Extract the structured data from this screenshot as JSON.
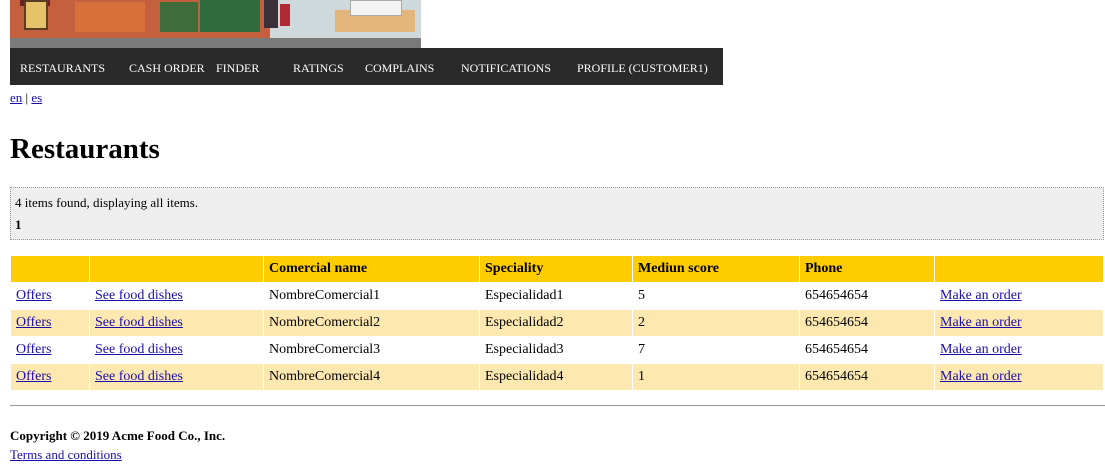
{
  "nav": {
    "items": [
      "RESTAURANTS",
      "CASH ORDER",
      "FINDER",
      "RATINGS",
      "COMPLAINS",
      "NOTIFICATIONS",
      "PROFILE (CUSTOMER1)"
    ]
  },
  "lang": {
    "en": "en",
    "separator": "|",
    "es": "es"
  },
  "page": {
    "title": "Restaurants"
  },
  "pager": {
    "found_text": "4 items found, displaying all items.",
    "current_page": "1"
  },
  "table": {
    "headers": [
      "",
      "",
      "Comercial name",
      "Speciality",
      "Mediun score",
      "Phone",
      ""
    ],
    "rows": [
      {
        "offers": "Offers",
        "dishes": "See food dishes",
        "name": "NombreComercial1",
        "speciality": "Especialidad1",
        "score": "5",
        "phone": "654654654",
        "order": "Make an order"
      },
      {
        "offers": "Offers",
        "dishes": "See food dishes",
        "name": "NombreComercial2",
        "speciality": "Especialidad2",
        "score": "2",
        "phone": "654654654",
        "order": "Make an order"
      },
      {
        "offers": "Offers",
        "dishes": "See food dishes",
        "name": "NombreComercial3",
        "speciality": "Especialidad3",
        "score": "7",
        "phone": "654654654",
        "order": "Make an order"
      },
      {
        "offers": "Offers",
        "dishes": "See food dishes",
        "name": "NombreComercial4",
        "speciality": "Especialidad4",
        "score": "1",
        "phone": "654654654",
        "order": "Make an order"
      }
    ]
  },
  "footer": {
    "copyright": "Copyright © 2019 Acme Food Co., Inc.",
    "terms": "Terms and conditions"
  },
  "colors": {
    "nav_bg": "#2a2a2a",
    "header_bg": "#ffcc00",
    "row_alt_bg": "#fde9b0",
    "link": "#1a0dab"
  }
}
